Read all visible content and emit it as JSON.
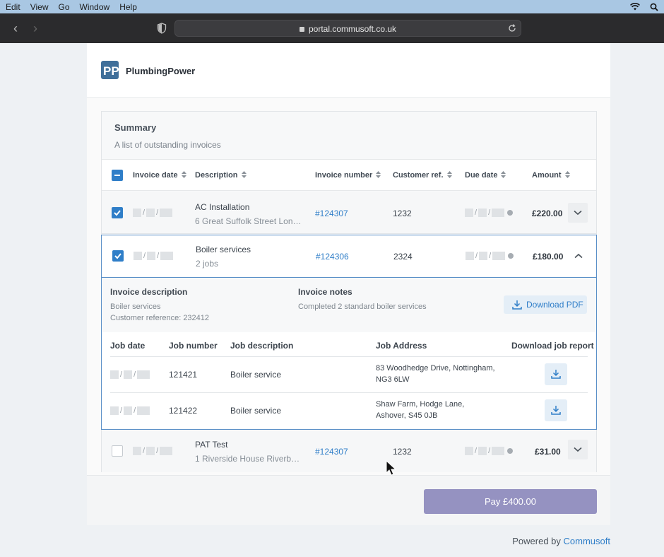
{
  "menubar": {
    "items": [
      "Edit",
      "View",
      "Go",
      "Window",
      "Help"
    ],
    "icons": [
      "wifi-icon",
      "search-icon"
    ]
  },
  "browser": {
    "url": "portal.commusoft.co.uk"
  },
  "brand": {
    "name": "PlumbingPower",
    "logo_text": "PP"
  },
  "summary": {
    "title": "Summary",
    "subtitle": "A list of outstanding invoices",
    "columns": [
      "Invoice date",
      "Description",
      "Invoice number",
      "Customer ref.",
      "Due date",
      "Amount"
    ],
    "rows": [
      {
        "selected": true,
        "date_sep": "/",
        "description": "AC Installation",
        "sub": "6 Great Suffolk Street Lond...",
        "invoice_number": "#124307",
        "customer_ref": "1232",
        "amount": "£220.00",
        "expanded": false
      },
      {
        "selected": true,
        "date_sep": "/",
        "description": "Boiler services",
        "sub": "2 jobs",
        "invoice_number": "#124306",
        "customer_ref": "2324",
        "amount": "£180.00",
        "expanded": true
      },
      {
        "selected": false,
        "date_sep": "/",
        "description": "PAT Test",
        "sub": "1 Riverside House Riverban...",
        "invoice_number": "#124307",
        "customer_ref": "1232",
        "amount": "£31.00",
        "expanded": false
      }
    ],
    "detail": {
      "desc_heading": "Invoice description",
      "desc_line1": "Boiler services",
      "desc_line2": "Customer reference: 232412",
      "notes_heading": "Invoice notes",
      "notes_text": "Completed 2 standard boiler services",
      "download_pdf": "Download PDF",
      "job_columns": [
        "Job date",
        "Job number",
        "Job description",
        "Job Address",
        "Download job report"
      ],
      "jobs": [
        {
          "job_number": "121421",
          "description": "Boiler service",
          "address1": "83 Woodhedge Drive, Nottingham,",
          "address2": "NG3 6LW"
        },
        {
          "job_number": "121422",
          "description": "Boiler service",
          "address1": "Shaw Farm, Hodge Lane,",
          "address2": "Ashover, S45 0JB"
        }
      ]
    }
  },
  "footer": {
    "pay_label": "Pay £400.00"
  },
  "powered": {
    "prefix": "Powered by ",
    "brand": "Commusoft"
  },
  "colors": {
    "accent": "#2f7ec8",
    "pay_button": "#9592c1",
    "selection_border": "#5a8fc7"
  }
}
